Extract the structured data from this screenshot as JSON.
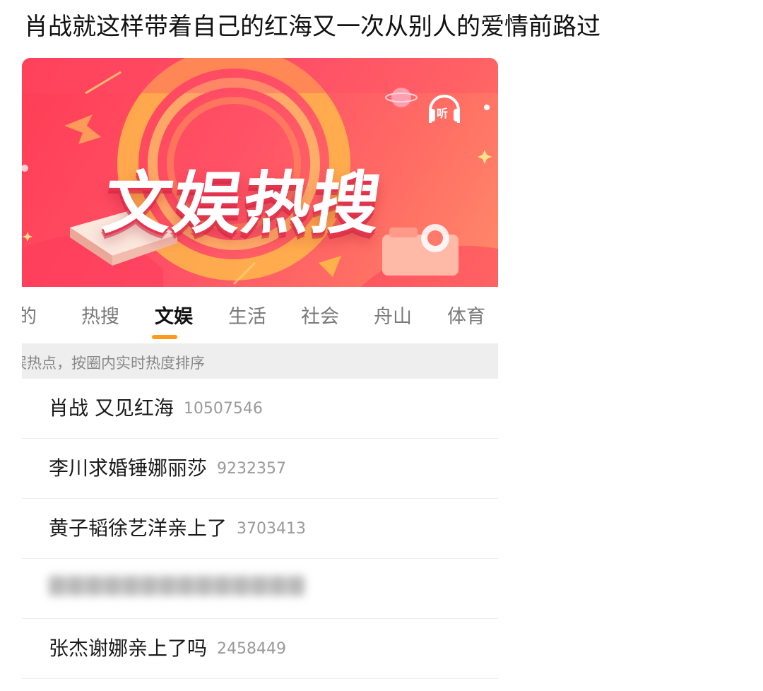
{
  "post": {
    "title": "肖战就这样带着自己的红海又一次从别人的爱情前路过"
  },
  "banner": {
    "title": "文娱热搜",
    "listen_label": "听",
    "colors": {
      "base": "#ff4a5e",
      "accent": "#ffb24a"
    }
  },
  "tabs": [
    {
      "label": "我的",
      "visible_text": "的"
    },
    {
      "label": "热搜"
    },
    {
      "label": "文娱",
      "active": true
    },
    {
      "label": "生活"
    },
    {
      "label": "社会"
    },
    {
      "label": "舟山"
    },
    {
      "label": "体育"
    }
  ],
  "notice": "娱热点，按圈内实时热度排序",
  "list": [
    {
      "title": "肖战 又见红海",
      "heat": "10507546"
    },
    {
      "title": "李川求婚锤娜丽莎",
      "heat": "9232357"
    },
    {
      "title": "黄子韬徐艺洋亲上了",
      "heat": "3703413"
    },
    {
      "title": "",
      "heat": "",
      "blurred": true
    },
    {
      "title": "张杰谢娜亲上了吗",
      "heat": "2458449"
    }
  ],
  "colors": {
    "tab_indicator": "#ff9a1a",
    "notice_bg": "#eeeeee"
  }
}
